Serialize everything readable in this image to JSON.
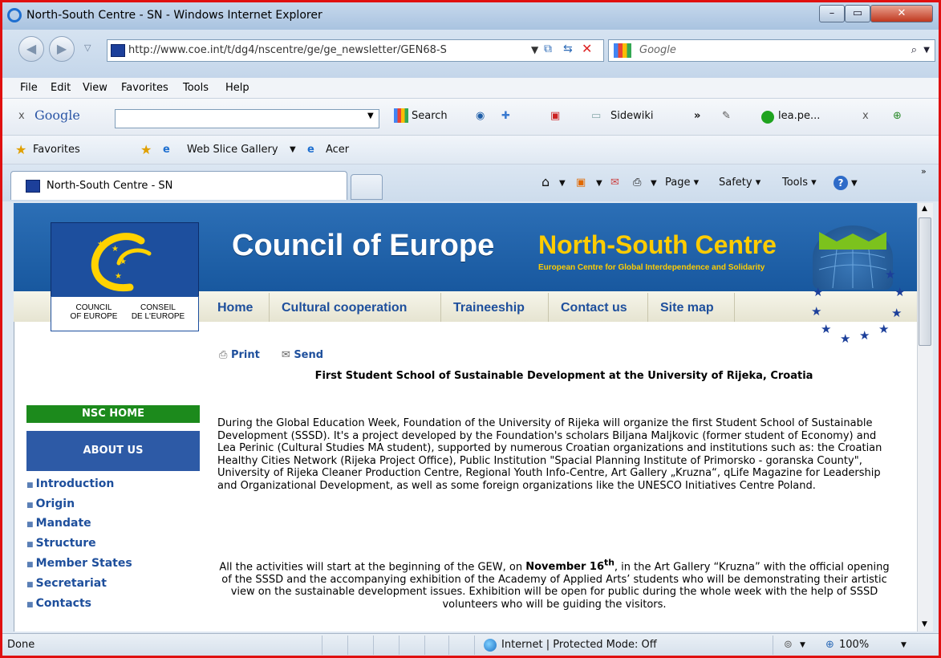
{
  "window": {
    "title": "North-South Centre - SN - Windows Internet Explorer"
  },
  "address": {
    "url": "http://www.coe.int/t/dg4/nscentre/ge/ge_newsletter/GEN68-S",
    "search_placeholder": "Google"
  },
  "menu": [
    "File",
    "Edit",
    "View",
    "Favorites",
    "Tools",
    "Help"
  ],
  "google_toolbar": {
    "close": "x",
    "brand": "Google",
    "search": "Search",
    "sidewiki": "Sidewiki",
    "more": "»",
    "account": "lea.pe...",
    "close2": "x"
  },
  "favorites_bar": {
    "favorites": "Favorites",
    "web_slice": "Web Slice Gallery",
    "acer": "Acer"
  },
  "tabs": {
    "active": "North-South Centre - SN",
    "page": "Page",
    "safety": "Safety",
    "tools": "Tools"
  },
  "banner": {
    "coe": "Council of Europe",
    "nsc": "North-South Centre",
    "nsc_sub": "European Centre for Global Interdependence and Solidarity",
    "logo_en": "COUNCIL\nOF EUROPE",
    "logo_fr": "CONSEIL\nDE L'EUROPE"
  },
  "nav": [
    "Home",
    "Cultural cooperation",
    "Traineeship",
    "Contact us",
    "Site map"
  ],
  "sidebar": {
    "home": "NSC HOME",
    "about": "ABOUT US",
    "items": [
      "Introduction",
      "Origin",
      "Mandate",
      "Structure",
      "Member States",
      "Secretariat",
      "Contacts"
    ]
  },
  "article": {
    "print": "Print",
    "send": "Send",
    "title": "First Student School of Sustainable Development at the University of Rijeka, Croatia",
    "p1": "During the Global Education Week, Foundation of the University of Rijeka will organize the first Student School of Sustainable Development (SSSD). It's a project developed by the Foundation's scholars Biljana Maljkovic (former student of Economy) and Lea Perinic (Cultural Studies MA student), supported by numerous Croatian organizations and institutions such as: the Croatian Healthy Cities Network (Rijeka Project Office), Public Institution \"Spacial Planning Institute of Primorsko - goranska County\", University of Rijeka Cleaner Production Centre, Regional Youth Info-Centre, Art Gallery „Kruzna“, qLife Magazine for Leadership and Organizational Development, as well as some foreign organizations like the UNESCO Initiatives Centre Poland.",
    "p2_a": "All the activities will start at the beginning of the GEW, on ",
    "p2_date": "November 16",
    "p2_sup": "th",
    "p2_b": ", in the Art Gallery “Kruzna” with the official opening of the SSSD and the accompanying exhibition of the Academy of Applied Arts’ students who will be demonstrating their artistic view on the sustainable development issues. Exhibition will be open for public during the whole week with the help of SSSD volunteers who will be guiding the visitors."
  },
  "status": {
    "left": "Done",
    "zone": "Internet | Protected Mode: Off",
    "zoom": "100%"
  },
  "colors": {
    "frame": "#e01010",
    "banner": "#1f5ea8",
    "nsc_gold": "#ffcc00",
    "nav_link": "#1e4f9c",
    "nsc_home": "#1c8a1c",
    "about_us": "#2d5aa6"
  }
}
